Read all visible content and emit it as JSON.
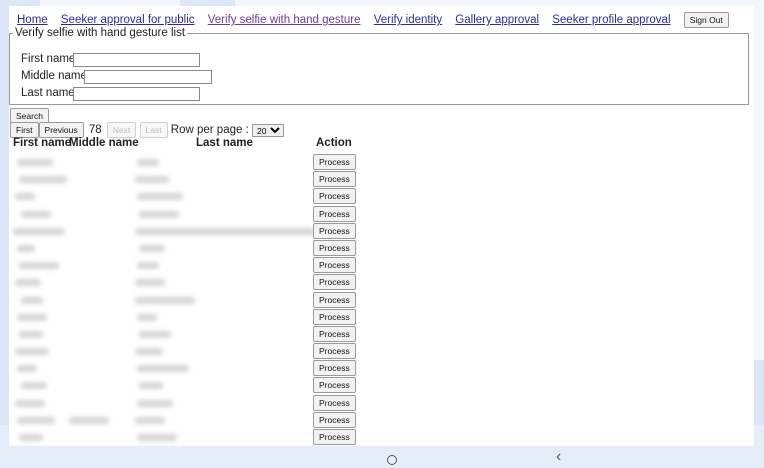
{
  "nav": {
    "links": [
      "Home",
      "Seeker approval for public",
      "Verify selfie with hand gesture",
      "Verify identity",
      "Gallery approval",
      "Seeker profile approval"
    ],
    "sign_out": "Sign Out"
  },
  "filter": {
    "legend": "Verify selfie with hand gesture list",
    "first_name_label": "First name",
    "middle_name_label": "Middle name",
    "last_name_label": "Last name",
    "first_name_value": "",
    "middle_name_value": "",
    "last_name_value": ""
  },
  "search_label": "Search",
  "pager": {
    "first": "First",
    "previous": "Previous",
    "count": "78",
    "next": "Next",
    "last": "Last",
    "rows_per_page_label": "Row per page :",
    "rows_per_page_value": "20"
  },
  "table": {
    "headers": [
      "First name",
      "Middle name",
      "Last name",
      "Action"
    ],
    "action_label": "Process",
    "row_count": 17
  }
}
